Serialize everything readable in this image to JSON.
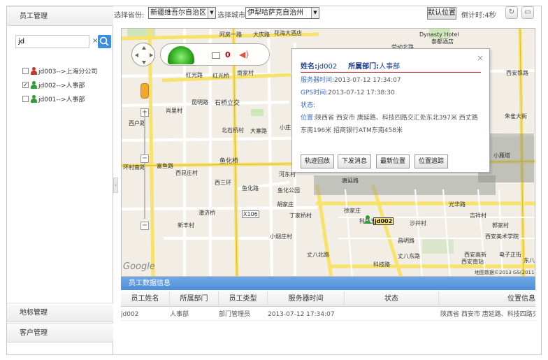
{
  "sidebar": {
    "employee_header": "员工管理",
    "search_value": "jd",
    "clear_symbol": "×",
    "tree": [
      {
        "label": "jd003-->上海分公司",
        "checked": false,
        "icon_color": "#c0392b"
      },
      {
        "label": "jd002-->人事部",
        "checked": true,
        "icon_color": "#2e9d3a"
      },
      {
        "label": "jd001-->人事部",
        "checked": false,
        "icon_color": "#2e9d3a"
      }
    ],
    "marker_header": "地标管理",
    "customer_header": "客户管理",
    "collapse_symbol": "‹"
  },
  "toolbar": {
    "province_label": "选择省份:",
    "province_value": "新疆维吾尔自治区",
    "city_label": "选择城市:",
    "city_value": "伊犁哈萨克自治州",
    "default_position_button": "默认位置",
    "countdown": "倒计时:4秒",
    "select_arrow": "▼"
  },
  "map": {
    "labels": [
      "阿房一路",
      "大庆路",
      "花海大酒店",
      "Dynasty Hotel",
      "泰都酒店",
      "劳动北路",
      "西安铁路",
      "红光路",
      "红光桥",
      "南家村",
      "昆明路",
      "石桥立交",
      "肖里村",
      "西户路",
      "北石桥村",
      "大寨路",
      "小庄",
      "鱼化桥",
      "环村南路",
      "富鱼路",
      "西昆庄村",
      "西三环",
      "鱼化路",
      "鱼化公园",
      "河东村",
      "丁家桥村",
      "胡家庄",
      "潘济桥",
      "新丰村",
      "X106",
      "小烟庄村",
      "丈八北路",
      "唐延路",
      "徐家庄",
      "科技路",
      "光华路",
      "西安高新",
      "沙井村",
      "吉祥村",
      "郭家村",
      "西安美术学院",
      "电子正街",
      "小雁塔",
      "朱雀大街",
      "昌明路",
      "科技五路",
      "丈八东路",
      "西安南站",
      "东八",
      "Google",
      "地图数据©2013 GS(2011)6"
    ],
    "mail_count": "0",
    "vehicle_label": "jd002",
    "popup": {
      "name_label": "姓名:",
      "name_value": "jd002",
      "dept_label": "所属部门:",
      "dept_value": "人事部",
      "server_time_label": "服务器时间:",
      "server_time_value": "2013-07-12 17:34:07",
      "gps_time_label": "GPS时间:",
      "gps_time_value": "2013-07-12 17:38:30",
      "status_label": "状态:",
      "location_label": "位置:",
      "location_line1": "陕西省 西安市 唐延路、科技四路交汇处东北397米 西丈路",
      "location_line2": "东南196米 招商银行ATM东南458米",
      "close_symbol": "×",
      "buttons": [
        "轨迹回放",
        "下发消息",
        "最新位置",
        "位置追踪"
      ]
    }
  },
  "grid": {
    "title": "员工数据信息",
    "headers": [
      "员工姓名",
      "所属部门",
      "员工类型",
      "服务器时间",
      "状态",
      "位置信息"
    ],
    "rows": [
      [
        "jd002",
        "人事部",
        "部门管理员",
        "2013-07-12 17:34:07",
        "",
        "陕西省 西安市 唐延路、科技四路交"
      ]
    ]
  },
  "colors": {
    "accent_blue": "#4e8ed8",
    "road_yellow": "#f7e26a",
    "road_white": "#ffffff",
    "popup_title": "#1a3a8c"
  }
}
